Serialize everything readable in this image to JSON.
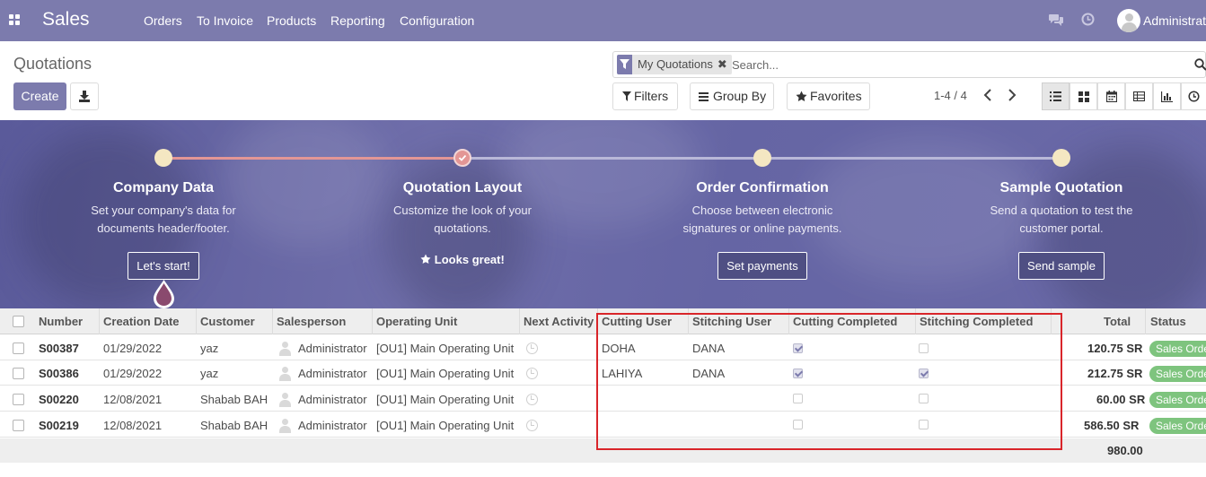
{
  "navbar": {
    "brand": "Sales",
    "menu": [
      "Orders",
      "To Invoice",
      "Products",
      "Reporting",
      "Configuration"
    ],
    "user_name": "Administrato",
    "icons": [
      "apps-icon",
      "chat-icon",
      "activity-clock-icon"
    ]
  },
  "control_panel": {
    "title": "Quotations",
    "create_label": "Create",
    "search": {
      "facet": "My Quotations",
      "facet_close": "✖",
      "placeholder": "Search..."
    },
    "filters_label": "Filters",
    "group_by_label": "Group By",
    "favorites_label": "Favorites",
    "pager": "1-4 / 4",
    "views": [
      "list",
      "kanban",
      "calendar",
      "pivot",
      "graph",
      "activity"
    ],
    "active_view": "list"
  },
  "onboarding": {
    "steps": [
      {
        "title": "Company Data",
        "desc_line1": "Set your company's data for",
        "desc_line2": "documents header/footer.",
        "button": "Let's start!",
        "done": false
      },
      {
        "title": "Quotation Layout",
        "desc_line1": "Customize the look of your",
        "desc_line2": "quotations.",
        "done_text": "Looks great!",
        "done": true
      },
      {
        "title": "Order Confirmation",
        "desc_line1": "Choose between electronic",
        "desc_line2": "signatures or online payments.",
        "button": "Set payments",
        "done": false
      },
      {
        "title": "Sample Quotation",
        "desc_line1": "Send a quotation to test the",
        "desc_line2": "customer portal.",
        "button": "Send sample",
        "done": false
      }
    ],
    "colors": {
      "progress_done": "#e39695",
      "progress_todo": "#b9b8d8",
      "dot": "#f4e7c2"
    }
  },
  "table": {
    "columns": [
      "Number",
      "Creation Date",
      "Customer",
      "Salesperson",
      "Operating Unit",
      "Next Activity",
      "Cutting User",
      "Stitching User",
      "Cutting Completed",
      "Stitching Completed",
      "Total",
      "Status"
    ],
    "rows": [
      {
        "number": "S00387",
        "date": "01/29/2022",
        "customer": "yaz",
        "salesperson": "Administrator",
        "unit": "[OU1] Main Operating Unit",
        "cutting_user": "DOHA",
        "stitching_user": "DANA",
        "cutting_completed": true,
        "stitching_completed": false,
        "total": "120.75 SR",
        "status": "Sales Order"
      },
      {
        "number": "S00386",
        "date": "01/29/2022",
        "customer": "yaz",
        "salesperson": "Administrator",
        "unit": "[OU1] Main Operating Unit",
        "cutting_user": "LAHIYA",
        "stitching_user": "DANA",
        "cutting_completed": true,
        "stitching_completed": true,
        "total": "212.75 SR",
        "status": "Sales Order"
      },
      {
        "number": "S00220",
        "date": "12/08/2021",
        "customer": "Shabab BAH",
        "salesperson": "Administrator",
        "unit": "[OU1] Main Operating Unit",
        "cutting_user": "",
        "stitching_user": "",
        "cutting_completed": false,
        "stitching_completed": false,
        "total": "60.00 SR",
        "status": "Sales Order"
      },
      {
        "number": "S00219",
        "date": "12/08/2021",
        "customer": "Shabab BAH",
        "salesperson": "Administrator",
        "unit": "[OU1] Main Operating Unit",
        "cutting_user": "",
        "stitching_user": "",
        "cutting_completed": false,
        "stitching_completed": false,
        "total": "586.50 SR",
        "status": "Sales Order"
      }
    ],
    "sum_total": "980.00",
    "status_color": "#7ec47e"
  },
  "annotation": {
    "highlight_color": "#d9252a"
  }
}
